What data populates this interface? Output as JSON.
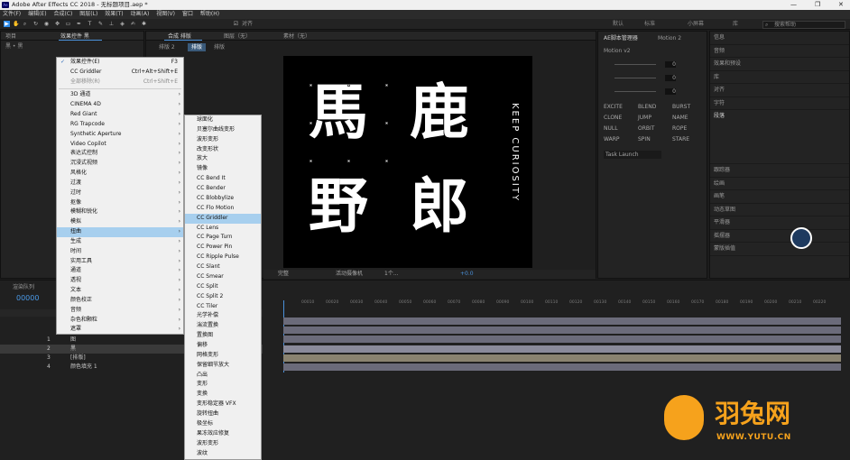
{
  "window": {
    "title": "Adobe After Effects CC 2018 - 无标题项目.aep *",
    "app_icon": "Ae"
  },
  "menubar": [
    "文件(F)",
    "编辑(E)",
    "合成(C)",
    "图层(L)",
    "效果(T)",
    "动画(A)",
    "视图(V)",
    "窗口",
    "帮助(H)"
  ],
  "toolbar": {
    "snap_label": "对齐",
    "workspaces": [
      "默认",
      "标准",
      "小屏幕",
      "库"
    ],
    "search_placeholder": "搜索帮助"
  },
  "project_panel": {
    "tab": "项目",
    "effects_tab": "效果控件 黑",
    "subtab": "黑 • 黑"
  },
  "comp_panel": {
    "tab": "合成 排版",
    "layer_tab": "图层（无）",
    "footage_tab": "素材（无）",
    "breadcrumb": [
      "排版 2",
      "排版"
    ],
    "breadcrumb_sub": "排版",
    "canvas_text": [
      "馬",
      "鹿",
      "野",
      "郎"
    ],
    "vertical_text": "KEEP CURIOSITY",
    "zoom": "完整",
    "camera": "活动摄像机",
    "views": "1个...",
    "exposure": "+0.0"
  },
  "ae_panel": {
    "title": "AE脚本管理器",
    "tab2": "Motion 2",
    "version": "Motion v2",
    "values": [
      "0",
      "0",
      "0"
    ],
    "buttons": [
      [
        "EXCITE",
        "BLEND",
        "BURST"
      ],
      [
        "CLONE",
        "JUMP",
        "NAME"
      ],
      [
        "NULL",
        "ORBIT",
        "ROPE"
      ],
      [
        "WARP",
        "SPIN",
        "STARE"
      ]
    ],
    "dropdown": "Task Launch"
  },
  "right_panel": {
    "items": [
      "信息",
      "音频",
      "效果和预设",
      "库",
      "对齐",
      "字符"
    ],
    "section": "段落",
    "lower_items": [
      "跟踪器",
      "绘画",
      "画笔",
      "动态草图",
      "平滑器",
      "摇摆器",
      "蒙版插值"
    ]
  },
  "timeline": {
    "tab": "渲染队列",
    "timecode": "00000",
    "ruler": [
      "00010",
      "00020",
      "00030",
      "00040",
      "00050",
      "00060",
      "00070",
      "00080",
      "00090",
      "00100",
      "00110",
      "00120",
      "00130",
      "00140",
      "00150",
      "00160",
      "00170",
      "00180",
      "00190",
      "00200",
      "00210",
      "00220"
    ],
    "layers": [
      {
        "num": "1",
        "name": "图",
        "color": "#6fb5c9"
      },
      {
        "num": "2",
        "name": "黑",
        "color": "#6fb5c9"
      },
      {
        "num": "3",
        "name": "[排版]",
        "color": "#c8c8c8"
      },
      {
        "num": "4",
        "name": "颜色填充 1",
        "color": "#6fb5c9"
      }
    ]
  },
  "context_menu": {
    "items": [
      {
        "label": "效果控件(E)",
        "shortcut": "F3",
        "checked": true
      },
      {
        "label": "CC Griddler",
        "shortcut": "Ctrl+Alt+Shift+E"
      },
      {
        "label": "全部移除(R)",
        "shortcut": "Ctrl+Shift+E",
        "dim": true
      },
      {
        "label": "3D 通道"
      },
      {
        "label": "CINEMA 4D"
      },
      {
        "label": "Red Giant"
      },
      {
        "label": "RG Trapcode"
      },
      {
        "label": "Synthetic Aperture"
      },
      {
        "label": "Video Copilot"
      },
      {
        "label": "表达式控制"
      },
      {
        "label": "沉浸式视频"
      },
      {
        "label": "风格化"
      },
      {
        "label": "过渡"
      },
      {
        "label": "过时"
      },
      {
        "label": "抠像"
      },
      {
        "label": "模糊和锐化"
      },
      {
        "label": "模拟"
      },
      {
        "label": "扭曲",
        "highlight": true
      },
      {
        "label": "生成"
      },
      {
        "label": "时间"
      },
      {
        "label": "实用工具"
      },
      {
        "label": "通道"
      },
      {
        "label": "透视"
      },
      {
        "label": "文本"
      },
      {
        "label": "颜色校正"
      },
      {
        "label": "音频"
      },
      {
        "label": "杂色和颗粒"
      },
      {
        "label": "遮罩"
      }
    ]
  },
  "submenu": {
    "items": [
      "球面化",
      "贝塞尔曲线变形",
      "波形变形",
      "改变形状",
      "放大",
      "镜像",
      "CC Bend It",
      "CC Bender",
      "CC Blobbylize",
      "CC Flo Motion",
      "CC Griddler",
      "CC Lens",
      "CC Page Turn",
      "CC Power Pin",
      "CC Ripple Pulse",
      "CC Slant",
      "CC Smear",
      "CC Split",
      "CC Split 2",
      "CC Tiler",
      "光学补偿",
      "湍流置换",
      "置换图",
      "偏移",
      "网格变形",
      "保留细节放大",
      "凸出",
      "变形",
      "变换",
      "变形稳定器 VFX",
      "旋转扭曲",
      "极坐标",
      "果冻效应修复",
      "波形变形",
      "波纹"
    ],
    "highlight_index": 10
  },
  "watermark": {
    "brand": "羽兔网",
    "url": "WWW.YUTU.CN"
  }
}
